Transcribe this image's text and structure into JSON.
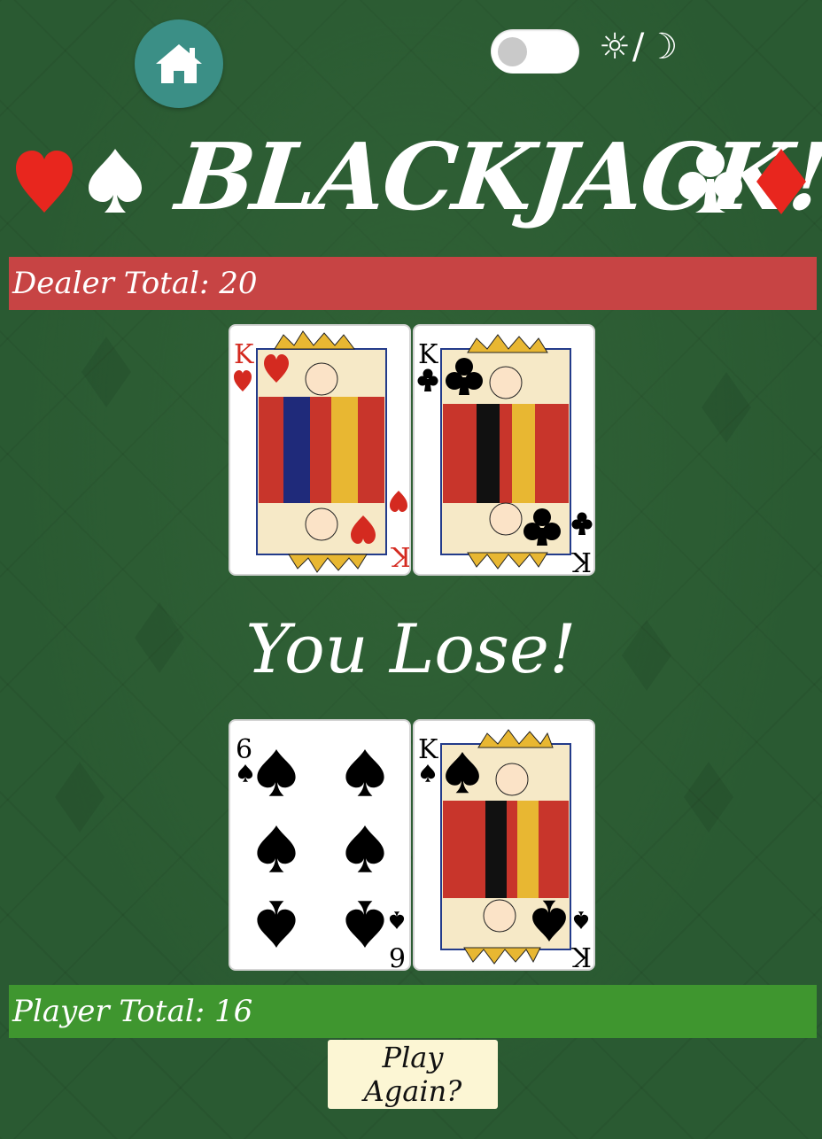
{
  "header": {
    "home_icon": "home-icon",
    "theme_toggle_label": "☼/☽",
    "theme_dark_mode": false
  },
  "title": {
    "text": "BLACKJACK!",
    "suits_left": [
      "heart",
      "spade"
    ],
    "suits_right": [
      "club",
      "diamond"
    ]
  },
  "dealer": {
    "total_label": "Dealer Total: 20",
    "cards": [
      {
        "rank": "K",
        "suit": "heart",
        "color": "#d42a20"
      },
      {
        "rank": "K",
        "suit": "club",
        "color": "#000000"
      }
    ]
  },
  "result": {
    "text": "You Lose!"
  },
  "player": {
    "total_label": "Player Total: 16",
    "cards": [
      {
        "rank": "6",
        "suit": "spade",
        "color": "#000000"
      },
      {
        "rank": "K",
        "suit": "spade",
        "color": "#000000"
      }
    ]
  },
  "actions": {
    "play_again_label": "Play Again?"
  },
  "colors": {
    "table_green": "#2a5a32",
    "dealer_bar": "#c74444",
    "player_bar": "#3f962f",
    "home_button": "#3b8f86",
    "play_again_bg": "#fcf6d4",
    "red_suit": "#e8261e"
  }
}
